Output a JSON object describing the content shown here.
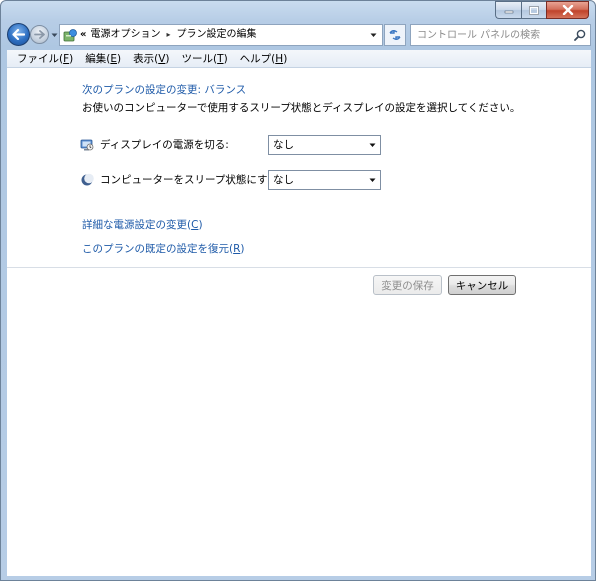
{
  "window": {
    "caption_buttons": [
      "minimize",
      "maximize",
      "close"
    ]
  },
  "navigation": {
    "back_icon": "back-arrow-icon",
    "forward_icon": "forward-arrow-icon"
  },
  "address_bar": {
    "overflow": "«",
    "segments": [
      "電源オプション",
      "プラン設定の編集"
    ],
    "separator": "▸"
  },
  "search": {
    "placeholder": "コントロール パネルの検索"
  },
  "menu": {
    "items": [
      {
        "label": "ファイル(",
        "key": "F",
        "end": ")"
      },
      {
        "label": "編集(",
        "key": "E",
        "end": ")"
      },
      {
        "label": "表示(",
        "key": "V",
        "end": ")"
      },
      {
        "label": "ツール(",
        "key": "T",
        "end": ")"
      },
      {
        "label": "ヘルプ(",
        "key": "H",
        "end": ")"
      }
    ]
  },
  "main": {
    "heading": "次のプランの設定の変更: バランス",
    "description": "お使いのコンピューターで使用するスリープ状態とディスプレイの設定を選択してください。",
    "settings": [
      {
        "label": "ディスプレイの電源を切る:",
        "value": "なし",
        "icon": "display-icon"
      },
      {
        "label": "コンピューターをスリープ状態にする:",
        "value": "なし",
        "icon": "moon-icon"
      }
    ],
    "links": [
      {
        "label": "詳細な電源設定の変更(",
        "key": "C",
        "end": ")"
      },
      {
        "label": "このプランの既定の設定を復元(",
        "key": "R",
        "end": ")"
      }
    ],
    "buttons": {
      "save": "変更の保存",
      "cancel": "キャンセル"
    }
  },
  "colors": {
    "link": "#1e5aa8",
    "frame": "#b7cde6",
    "close_button": "#c0432b"
  }
}
